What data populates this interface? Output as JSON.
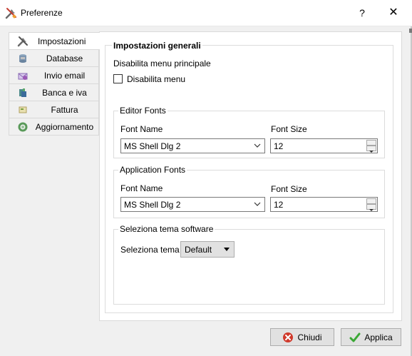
{
  "window": {
    "title": "Preferenze",
    "help_label": "?",
    "close_label": "✕"
  },
  "nav": {
    "items": [
      {
        "label": "Impostazioni",
        "icon": "tools-icon",
        "active": true
      },
      {
        "label": "Database",
        "icon": "database-icon",
        "active": false
      },
      {
        "label": "Invio email",
        "icon": "email-icon",
        "active": false
      },
      {
        "label": "Banca e iva",
        "icon": "bank-icon",
        "active": false
      },
      {
        "label": "Fattura",
        "icon": "invoice-icon",
        "active": false
      },
      {
        "label": "Aggiornamento",
        "icon": "update-icon",
        "active": false
      }
    ]
  },
  "general": {
    "title": "Impostazioni generali",
    "disable_menu_heading": "Disabilita menu principale",
    "disable_menu_checkbox": "Disabilita menu",
    "disable_menu_checked": false
  },
  "editor_fonts": {
    "title": "Editor Fonts",
    "font_name_label": "Font Name",
    "font_size_label": "Font Size",
    "font_name_value": "MS Shell Dlg 2",
    "font_size_value": "12"
  },
  "application_fonts": {
    "title": "Application Fonts",
    "font_name_label": "Font Name",
    "font_size_label": "Font Size",
    "font_name_value": "MS Shell Dlg 2",
    "font_size_value": "12"
  },
  "theme": {
    "title": "Seleziona tema software",
    "label": "Seleziona tema",
    "value": "Default"
  },
  "buttons": {
    "close_label": "Chiudi",
    "apply_label": "Applica"
  },
  "colors": {
    "close_icon": "#d03a2c",
    "apply_icon": "#3aa835",
    "border": "#d9d9d9"
  }
}
